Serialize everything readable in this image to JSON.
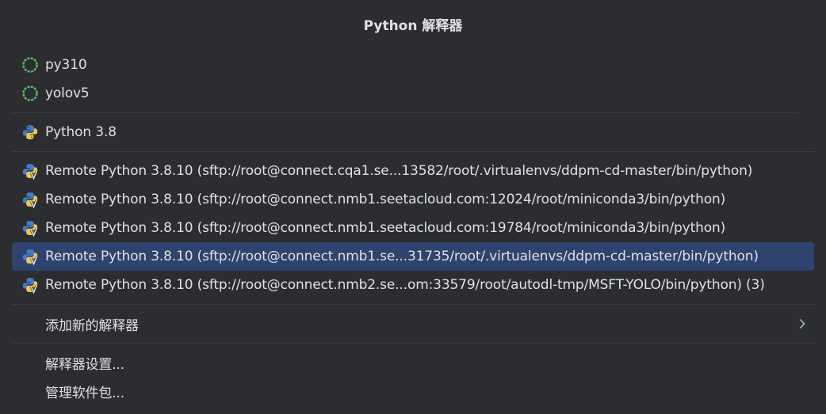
{
  "popup": {
    "title": "Python 解释器"
  },
  "conda_envs": [
    {
      "label": "py310"
    },
    {
      "label": "yolov5"
    }
  ],
  "local_interpreters": [
    {
      "label": "Python 3.8"
    }
  ],
  "remote_interpreters": [
    {
      "label": "Remote Python 3.8.10 (sftp://root@connect.cqa1.se...13582/root/.virtualenvs/ddpm-cd-master/bin/python)",
      "selected": false
    },
    {
      "label": "Remote Python 3.8.10 (sftp://root@connect.nmb1.seetacloud.com:12024/root/miniconda3/bin/python)",
      "selected": false
    },
    {
      "label": "Remote Python 3.8.10 (sftp://root@connect.nmb1.seetacloud.com:19784/root/miniconda3/bin/python)",
      "selected": false
    },
    {
      "label": "Remote Python 3.8.10 (sftp://root@connect.nmb1.se...31735/root/.virtualenvs/ddpm-cd-master/bin/python)",
      "selected": true
    },
    {
      "label": "Remote Python 3.8.10 (sftp://root@connect.nmb2.se...om:33579/root/autodl-tmp/MSFT-YOLO/bin/python) (3)",
      "selected": false
    }
  ],
  "actions": {
    "add_new": "添加新的解释器",
    "settings": "解释器设置...",
    "manage_packages": "管理软件包..."
  },
  "colors": {
    "background": "#2b2d30",
    "selected": "#2e436e",
    "separator": "#393b40",
    "text": "#dfe1e5",
    "conda_ring": "#5fb865"
  }
}
